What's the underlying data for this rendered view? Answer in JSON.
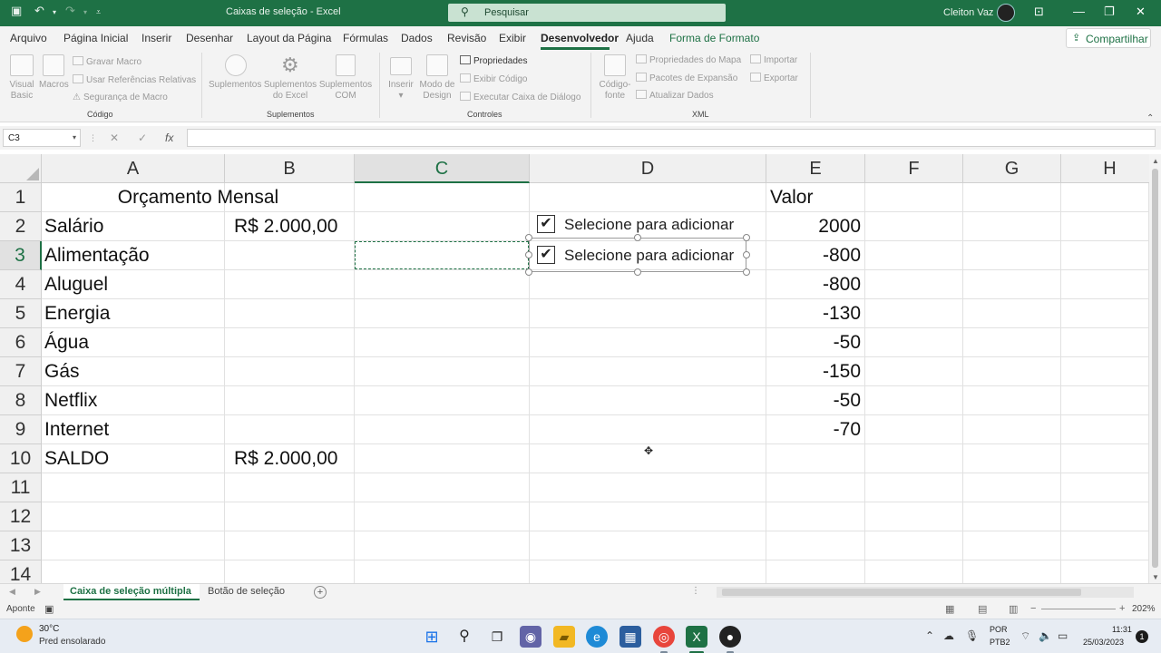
{
  "titlebar": {
    "title": "Caixas de seleção  -  Excel",
    "search_placeholder": "Pesquisar",
    "user": "Cleiton Vaz",
    "save_icon": "save-icon",
    "undo_glyph": "↶",
    "redo_glyph": "↷"
  },
  "menu": {
    "items": [
      "Arquivo",
      "Página Inicial",
      "Inserir",
      "Desenhar",
      "Layout da Página",
      "Fórmulas",
      "Dados",
      "Revisão",
      "Exibir",
      "Desenvolvedor",
      "Ajuda",
      "Forma de Formato"
    ],
    "share": "Compartilhar"
  },
  "ribbon": {
    "codigo": {
      "visual_basic_1": "Visual",
      "visual_basic_2": "Basic",
      "macros": "Macros",
      "gravar_macro": "Gravar Macro",
      "usar_referencias": "Usar Referências Relativas",
      "seguranca_macro": "Segurança de Macro",
      "group": "Código"
    },
    "suplementos": {
      "suplementos": "Suplementos",
      "suplementos_excel_1": "Suplementos",
      "suplementos_excel_2": "do Excel",
      "suplementos_com_1": "Suplementos",
      "suplementos_com_2": "COM",
      "group": "Suplementos"
    },
    "controles": {
      "inserir": "Inserir",
      "modo_design_1": "Modo de",
      "modo_design_2": "Design",
      "propriedades": "Propriedades",
      "exibir_codigo": "Exibir Código",
      "executar_caixa": "Executar Caixa de Diálogo",
      "group": "Controles"
    },
    "xml": {
      "codigo_fonte_1": "Código-",
      "codigo_fonte_2": "fonte",
      "propriedades_mapa": "Propriedades do Mapa",
      "pacotes_expansao": "Pacotes de Expansão",
      "atualizar_dados": "Atualizar Dados",
      "importar": "Importar",
      "exportar": "Exportar",
      "group": "XML"
    }
  },
  "formula_bar": {
    "name_box": "C3",
    "cancel": "✕",
    "enter": "✓",
    "fx": "fx",
    "value": ""
  },
  "sheet": {
    "columns": [
      "A",
      "B",
      "C",
      "D",
      "E",
      "F",
      "G",
      "H"
    ],
    "rows": [
      "1",
      "2",
      "3",
      "4",
      "5",
      "6",
      "7",
      "8",
      "9",
      "10",
      "11",
      "12",
      "13",
      "14"
    ],
    "title": "Orçamento Mensal",
    "valor_header": "Valor",
    "items": [
      {
        "label": "Salário",
        "b": "R$  2.000,00",
        "valor": "2000"
      },
      {
        "label": "Alimentação",
        "b": "",
        "valor": "-800"
      },
      {
        "label": "Aluguel",
        "b": "",
        "valor": "-800"
      },
      {
        "label": "Energia",
        "b": "",
        "valor": "-130"
      },
      {
        "label": "Água",
        "b": "",
        "valor": "-50"
      },
      {
        "label": "Gás",
        "b": "",
        "valor": "-150"
      },
      {
        "label": "Netflix",
        "b": "",
        "valor": "-50"
      },
      {
        "label": "Internet",
        "b": "",
        "valor": "-70"
      }
    ],
    "saldo_label": "SALDO",
    "saldo_value": "R$  2.000,00",
    "checkboxes": [
      {
        "label": "Selecione para adicionar",
        "checked": true
      },
      {
        "label": "Selecione para adicionar",
        "checked": true
      }
    ],
    "check_glyph": "✔"
  },
  "tabs": {
    "items": [
      "Caixa de seleção múltipla",
      "Botão de seleção"
    ],
    "add": "+"
  },
  "status": {
    "mode": "Aponte",
    "zoom": "202%"
  },
  "taskbar": {
    "temperature": "30°C",
    "weather": "Pred ensolarado",
    "lang1": "POR",
    "lang2": "PTB2",
    "time": "11:31",
    "date": "25/03/2023",
    "notifications": "1"
  }
}
